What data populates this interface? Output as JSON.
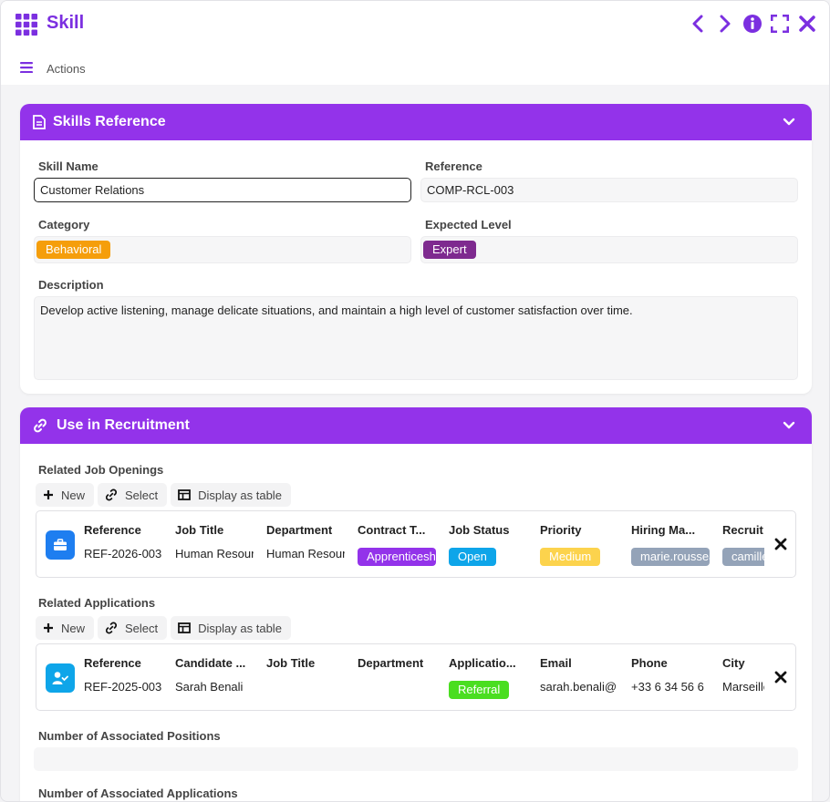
{
  "app": {
    "title": "Skill",
    "actions_label": "Actions"
  },
  "colors": {
    "accent": "#9333ea",
    "title": "#7b2fe0"
  },
  "skills_reference": {
    "title": "Skills Reference",
    "skill_name_label": "Skill Name",
    "skill_name_value": "Customer Relations",
    "reference_label": "Reference",
    "reference_value": "COMP-RCL-003",
    "category_label": "Category",
    "category_value": "Behavioral",
    "expected_level_label": "Expected Level",
    "expected_level_value": "Expert",
    "description_label": "Description",
    "description_value": "Develop active listening, manage delicate situations, and maintain a high level of customer satisfaction over time."
  },
  "recruitment": {
    "title": "Use in Recruitment",
    "buttons": {
      "new": "New",
      "select": "Select",
      "display_table": "Display as table"
    },
    "job_openings": {
      "label": "Related Job Openings",
      "headers": [
        "Reference",
        "Job Title",
        "Department",
        "Contract T...",
        "Job Status",
        "Priority",
        "Hiring Ma...",
        "Recruit"
      ],
      "row": {
        "reference": "REF-2026-003",
        "job_title": "Human Resources",
        "department": "Human Resources",
        "contract": "Apprenticeship",
        "status": "Open",
        "priority": "Medium",
        "hiring_manager": "marie.rousseau",
        "recruiter": "camille"
      }
    },
    "applications": {
      "label": "Related Applications",
      "headers": [
        "Reference",
        "Candidate ...",
        "Job Title",
        "Department",
        "Applicatio...",
        "Email",
        "Phone",
        "City"
      ],
      "row": {
        "reference": "REF-2025-003",
        "candidate": "Sarah Benali",
        "job_title": "",
        "department": "",
        "source": "Referral",
        "email": "sarah.benali@",
        "phone": "+33 6 34 56 6",
        "city": "Marseille"
      }
    },
    "positions_label": "Number of Associated Positions",
    "positions_value": "",
    "applications_count_label": "Number of Associated Applications"
  }
}
